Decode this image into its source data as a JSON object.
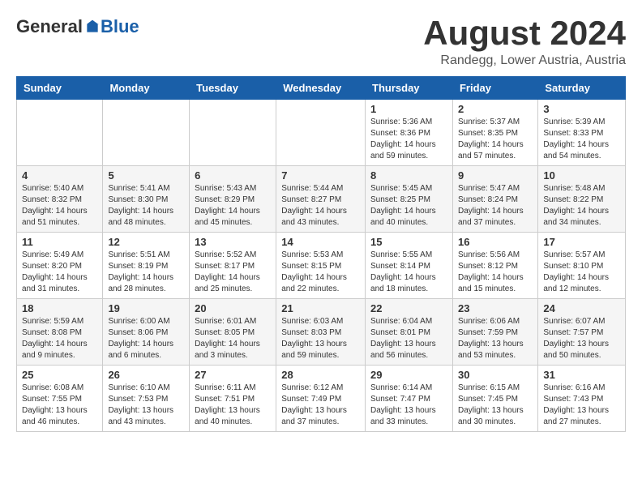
{
  "header": {
    "logo_general": "General",
    "logo_blue": "Blue",
    "month_year": "August 2024",
    "location": "Randegg, Lower Austria, Austria"
  },
  "calendar": {
    "days_of_week": [
      "Sunday",
      "Monday",
      "Tuesday",
      "Wednesday",
      "Thursday",
      "Friday",
      "Saturday"
    ],
    "weeks": [
      [
        {
          "day": "",
          "info": ""
        },
        {
          "day": "",
          "info": ""
        },
        {
          "day": "",
          "info": ""
        },
        {
          "day": "",
          "info": ""
        },
        {
          "day": "1",
          "info": "Sunrise: 5:36 AM\nSunset: 8:36 PM\nDaylight: 14 hours\nand 59 minutes."
        },
        {
          "day": "2",
          "info": "Sunrise: 5:37 AM\nSunset: 8:35 PM\nDaylight: 14 hours\nand 57 minutes."
        },
        {
          "day": "3",
          "info": "Sunrise: 5:39 AM\nSunset: 8:33 PM\nDaylight: 14 hours\nand 54 minutes."
        }
      ],
      [
        {
          "day": "4",
          "info": "Sunrise: 5:40 AM\nSunset: 8:32 PM\nDaylight: 14 hours\nand 51 minutes."
        },
        {
          "day": "5",
          "info": "Sunrise: 5:41 AM\nSunset: 8:30 PM\nDaylight: 14 hours\nand 48 minutes."
        },
        {
          "day": "6",
          "info": "Sunrise: 5:43 AM\nSunset: 8:29 PM\nDaylight: 14 hours\nand 45 minutes."
        },
        {
          "day": "7",
          "info": "Sunrise: 5:44 AM\nSunset: 8:27 PM\nDaylight: 14 hours\nand 43 minutes."
        },
        {
          "day": "8",
          "info": "Sunrise: 5:45 AM\nSunset: 8:25 PM\nDaylight: 14 hours\nand 40 minutes."
        },
        {
          "day": "9",
          "info": "Sunrise: 5:47 AM\nSunset: 8:24 PM\nDaylight: 14 hours\nand 37 minutes."
        },
        {
          "day": "10",
          "info": "Sunrise: 5:48 AM\nSunset: 8:22 PM\nDaylight: 14 hours\nand 34 minutes."
        }
      ],
      [
        {
          "day": "11",
          "info": "Sunrise: 5:49 AM\nSunset: 8:20 PM\nDaylight: 14 hours\nand 31 minutes."
        },
        {
          "day": "12",
          "info": "Sunrise: 5:51 AM\nSunset: 8:19 PM\nDaylight: 14 hours\nand 28 minutes."
        },
        {
          "day": "13",
          "info": "Sunrise: 5:52 AM\nSunset: 8:17 PM\nDaylight: 14 hours\nand 25 minutes."
        },
        {
          "day": "14",
          "info": "Sunrise: 5:53 AM\nSunset: 8:15 PM\nDaylight: 14 hours\nand 22 minutes."
        },
        {
          "day": "15",
          "info": "Sunrise: 5:55 AM\nSunset: 8:14 PM\nDaylight: 14 hours\nand 18 minutes."
        },
        {
          "day": "16",
          "info": "Sunrise: 5:56 AM\nSunset: 8:12 PM\nDaylight: 14 hours\nand 15 minutes."
        },
        {
          "day": "17",
          "info": "Sunrise: 5:57 AM\nSunset: 8:10 PM\nDaylight: 14 hours\nand 12 minutes."
        }
      ],
      [
        {
          "day": "18",
          "info": "Sunrise: 5:59 AM\nSunset: 8:08 PM\nDaylight: 14 hours\nand 9 minutes."
        },
        {
          "day": "19",
          "info": "Sunrise: 6:00 AM\nSunset: 8:06 PM\nDaylight: 14 hours\nand 6 minutes."
        },
        {
          "day": "20",
          "info": "Sunrise: 6:01 AM\nSunset: 8:05 PM\nDaylight: 14 hours\nand 3 minutes."
        },
        {
          "day": "21",
          "info": "Sunrise: 6:03 AM\nSunset: 8:03 PM\nDaylight: 13 hours\nand 59 minutes."
        },
        {
          "day": "22",
          "info": "Sunrise: 6:04 AM\nSunset: 8:01 PM\nDaylight: 13 hours\nand 56 minutes."
        },
        {
          "day": "23",
          "info": "Sunrise: 6:06 AM\nSunset: 7:59 PM\nDaylight: 13 hours\nand 53 minutes."
        },
        {
          "day": "24",
          "info": "Sunrise: 6:07 AM\nSunset: 7:57 PM\nDaylight: 13 hours\nand 50 minutes."
        }
      ],
      [
        {
          "day": "25",
          "info": "Sunrise: 6:08 AM\nSunset: 7:55 PM\nDaylight: 13 hours\nand 46 minutes."
        },
        {
          "day": "26",
          "info": "Sunrise: 6:10 AM\nSunset: 7:53 PM\nDaylight: 13 hours\nand 43 minutes."
        },
        {
          "day": "27",
          "info": "Sunrise: 6:11 AM\nSunset: 7:51 PM\nDaylight: 13 hours\nand 40 minutes."
        },
        {
          "day": "28",
          "info": "Sunrise: 6:12 AM\nSunset: 7:49 PM\nDaylight: 13 hours\nand 37 minutes."
        },
        {
          "day": "29",
          "info": "Sunrise: 6:14 AM\nSunset: 7:47 PM\nDaylight: 13 hours\nand 33 minutes."
        },
        {
          "day": "30",
          "info": "Sunrise: 6:15 AM\nSunset: 7:45 PM\nDaylight: 13 hours\nand 30 minutes."
        },
        {
          "day": "31",
          "info": "Sunrise: 6:16 AM\nSunset: 7:43 PM\nDaylight: 13 hours\nand 27 minutes."
        }
      ]
    ]
  }
}
